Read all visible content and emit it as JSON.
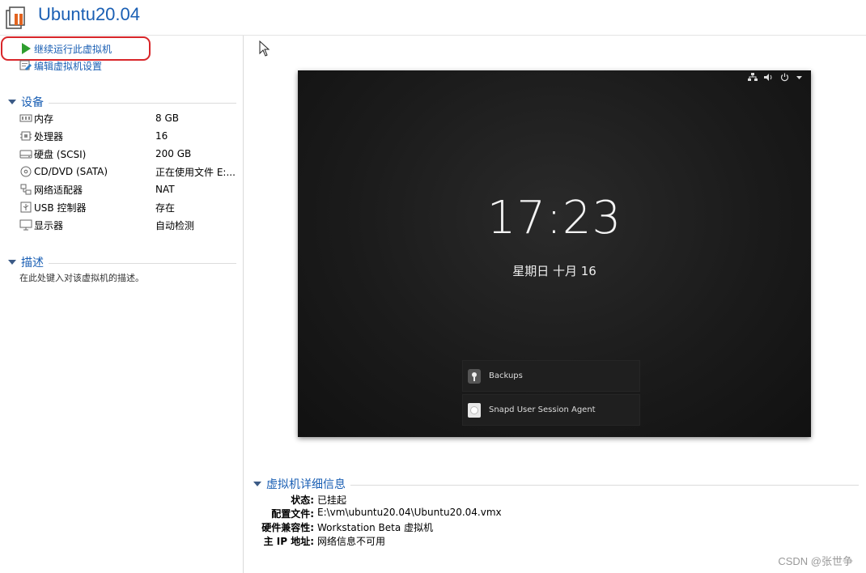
{
  "header": {
    "title": "Ubuntu20.04"
  },
  "actions": {
    "resume_label": "继续运行此虚拟机",
    "edit_label": "编辑虚拟机设置"
  },
  "devices": {
    "heading": "设备",
    "items": [
      {
        "icon": "memory-icon",
        "name": "内存",
        "value": "8 GB"
      },
      {
        "icon": "cpu-icon",
        "name": "处理器",
        "value": "16"
      },
      {
        "icon": "harddisk-icon",
        "name": "硬盘 (SCSI)",
        "value": "200 GB"
      },
      {
        "icon": "cd-dvd-icon",
        "name": "CD/DVD (SATA)",
        "value": "正在使用文件 E:..."
      },
      {
        "icon": "network-adapter-icon",
        "name": "网络适配器",
        "value": "NAT"
      },
      {
        "icon": "usb-icon",
        "name": "USB 控制器",
        "value": "存在"
      },
      {
        "icon": "display-icon",
        "name": "显示器",
        "value": "自动检测"
      }
    ]
  },
  "description": {
    "heading": "描述",
    "placeholder": "在此处键入对该虚拟机的描述。"
  },
  "vm_screen": {
    "time": "17:23",
    "date": "星期日 十月 16",
    "notifications": [
      {
        "icon": "backups-icon",
        "label": "Backups"
      },
      {
        "icon": "snapd-icon",
        "label": "Snapd User Session Agent"
      }
    ],
    "tray_icons": [
      "network-icon",
      "volume-icon",
      "power-icon",
      "dropdown-icon"
    ]
  },
  "details": {
    "heading": "虚拟机详细信息",
    "rows": [
      {
        "label": "状态:",
        "value": "已挂起"
      },
      {
        "label": "配置文件:",
        "value": "E:\\vm\\ubuntu20.04\\Ubuntu20.04.vmx"
      },
      {
        "label": "硬件兼容性:",
        "value": "Workstation Beta 虚拟机"
      },
      {
        "label": "主 IP 地址:",
        "value": "网络信息不可用"
      }
    ]
  },
  "watermark": "CSDN @张世争",
  "colors": {
    "accent": "#1a5fb4",
    "play": "#2e9e2e",
    "highlight": "#d8262a"
  }
}
